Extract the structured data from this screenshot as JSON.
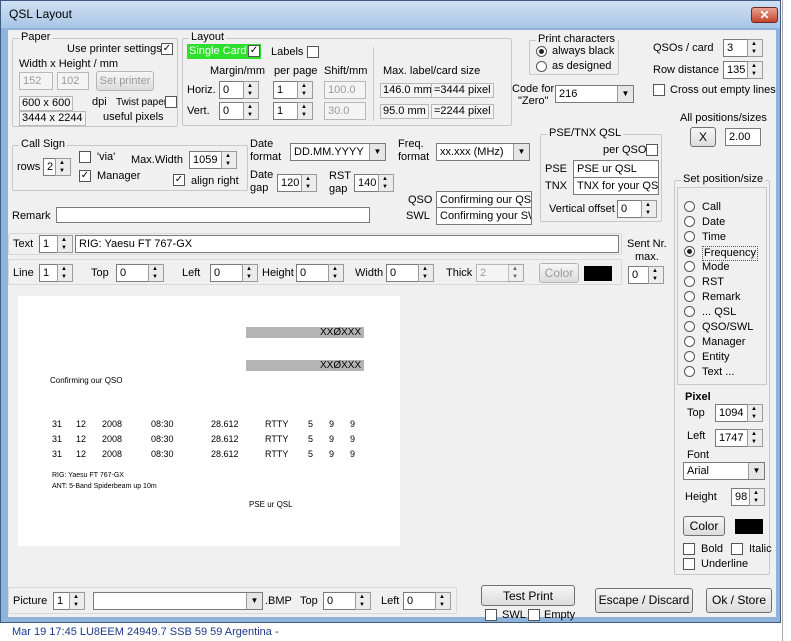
{
  "window": {
    "title": "QSL Layout",
    "close_glyph": "✕"
  },
  "paper": {
    "label": "Paper",
    "use_printer_settings": "Use printer settings",
    "use_printer_checked": "✓",
    "width_height_label": "Width x Height / mm",
    "width": "152",
    "height": "102",
    "set_printer": "Set printer",
    "dpi_value": "600 x 600",
    "dpi_label": "dpi",
    "twist_paper": "Twist paper",
    "useful_pixels_value": "3444 x 2244",
    "useful_pixels_label": "useful pixels"
  },
  "layout": {
    "label": "Layout",
    "single_card": "Single Card",
    "single_card_checked": "✓",
    "labels": "Labels",
    "margin_label": "Margin/mm",
    "per_page_label": "per page",
    "shift_label": "Shift/mm",
    "horiz_label": "Horiz.",
    "vert_label": "Vert.",
    "margin_h": "0",
    "margin_v": "0",
    "per_page_h": "1",
    "per_page_v": "1",
    "shift_h": "100.0",
    "shift_v": "30.0",
    "max_label": "Max. label/card size",
    "max_w_mm": "146.0 mm",
    "max_w_px": "=3444 pixel",
    "max_h_mm": "95.0 mm",
    "max_h_px": "=2244 pixel"
  },
  "code_zero": {
    "label": "Code for \"Zero\"",
    "value": "216"
  },
  "print_chars": {
    "label": "Print characters",
    "always_black": "always black",
    "as_designed": "as designed"
  },
  "qsos": {
    "per_card_label": "QSOs / card",
    "per_card": "3",
    "row_distance_label": "Row distance",
    "row_distance": "135",
    "cross_out": "Cross out empty lines"
  },
  "all_positions": {
    "label": "All positions/sizes",
    "x_button": "X",
    "factor": "2.00"
  },
  "callsign": {
    "label": "Call Sign",
    "rows_label": "rows",
    "rows": "2",
    "via": "'via'",
    "manager": "Manager",
    "manager_checked": "✓",
    "max_width_label": "Max.Width",
    "max_width": "1059",
    "align_right": "align right",
    "align_right_checked": "✓"
  },
  "date": {
    "format_label1": "Date",
    "format_label2": "format",
    "format": "DD.MM.YYYY",
    "gap_label1": "Date",
    "gap_label2": "gap",
    "gap": "120"
  },
  "rst": {
    "label1": "RST",
    "label2": "gap",
    "gap": "140"
  },
  "freq": {
    "label1": "Freq.",
    "label2": "format",
    "format": "xx.xxx (MHz)"
  },
  "pse_tnx": {
    "label": "PSE/TNX QSL",
    "per_qso": "per QSO",
    "pse_label": "PSE",
    "pse_value": "PSE ur QSL",
    "tnx_label": "TNX",
    "tnx_value": "TNX for your QSL",
    "vertical_offset_label": "Vertical offset",
    "vertical_offset": "0"
  },
  "qso_swl": {
    "qso_label": "QSO",
    "qso_value": "Confirming our QSO",
    "swl_label": "SWL",
    "swl_value": "Confirming your SWL"
  },
  "remark": {
    "label": "Remark",
    "value": ""
  },
  "text_row": {
    "label": "Text",
    "index": "1",
    "value": "RIG: Yaesu FT 767-GX"
  },
  "sent_nr": {
    "label1": "Sent Nr.",
    "label2": "max.",
    "value": "0"
  },
  "line_row": {
    "line_label": "Line",
    "line": "1",
    "top_label": "Top",
    "top": "0",
    "left_label": "Left",
    "left": "0",
    "height_label": "Height",
    "height": "0",
    "width_label": "Width",
    "width": "0",
    "thick_label": "Thick",
    "thick": "2",
    "color_button": "Color"
  },
  "preview": {
    "callsign_placeholder": "XXØXXX",
    "confirm_text": "Confirming our QSO",
    "rows": [
      [
        "31",
        "12",
        "2008",
        "08:30",
        "28.612",
        "RTTY",
        "5",
        "9",
        "9"
      ],
      [
        "31",
        "12",
        "2008",
        "08:30",
        "28.612",
        "RTTY",
        "5",
        "9",
        "9"
      ],
      [
        "31",
        "12",
        "2008",
        "08:30",
        "28.612",
        "RTTY",
        "5",
        "9",
        "9"
      ]
    ],
    "rig": "RIG: Yaesu FT 767-GX",
    "ant": "ANT: 5-Band Spiderbeam up 10m",
    "pse": "PSE ur QSL"
  },
  "set_position": {
    "label": "Set position/size",
    "items": [
      "Call",
      "Date",
      "Time",
      "Frequency",
      "Mode",
      "RST",
      "Remark",
      "... QSL",
      "QSO/SWL",
      "Manager",
      "Entity",
      "Text ..."
    ],
    "selected": "Frequency",
    "pixel_label": "Pixel",
    "top_label": "Top",
    "top": "1094",
    "left_label": "Left",
    "left": "1747",
    "font_label": "Font",
    "font": "Arial",
    "height_label": "Height",
    "height": "98",
    "color_button": "Color",
    "bold": "Bold",
    "italic": "Italic",
    "underline": "Underline"
  },
  "picture": {
    "label": "Picture",
    "index": "1",
    "file": "",
    "ext": ".BMP",
    "top_label": "Top",
    "top": "0",
    "left_label": "Left",
    "left": "0"
  },
  "buttons": {
    "test_print": "Test Print",
    "swl": "SWL",
    "empty": "Empty",
    "escape": "Escape / Discard",
    "ok": "Ok / Store"
  },
  "background_log": {
    "row": "Mar 19  17:45  LU8EEM          24949.7  SSB       59    59    Argentina -"
  }
}
